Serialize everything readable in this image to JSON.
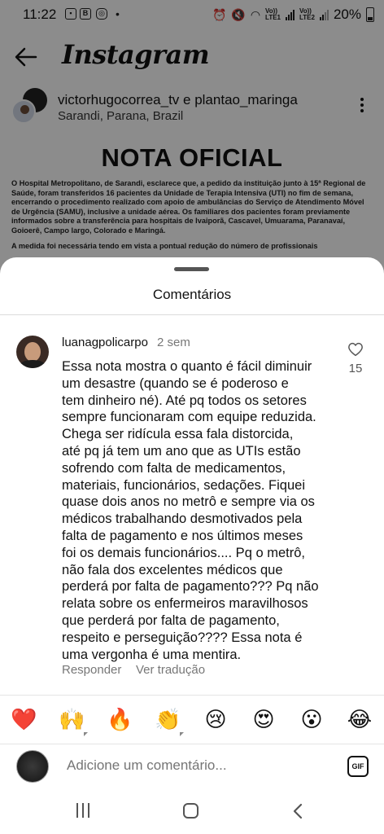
{
  "status_bar": {
    "time": "11:22",
    "dot": "•",
    "battery": "20%",
    "sim1": "Vo))\nLTE1",
    "sim2": "Vo))\nLTE2"
  },
  "header": {
    "logo": "Instagram",
    "back_icon": "arrow-left-icon"
  },
  "post": {
    "authors": "victorhugocorrea_tv e plantao_maringa",
    "location": "Sarandi, Parana, Brazil",
    "headline": "NOTA OFICIAL",
    "text": "O Hospital Metropolitano, de Sarandi, esclarece que, a pedido da instituição junto à 15ª Regional de Saúde, foram transferidos 16 pacientes da Unidade de Terapia Intensiva (UTI) no fim de semana, encerrando o procedimento realizado com apoio de ambulâncias do Serviço de Atendimento Móvel de Urgência (SAMU), inclusive a unidade aérea. Os familiares dos pacientes foram previamente informados sobre a transferência para hospitais de Ivaiporã, Cascavel, Umuarama, Paranavaí, Goioerê, Campo largo, Colorado e Maringá.",
    "text2": "A medida foi necessária tendo em vista a pontual redução do número de profissionais"
  },
  "comments_sheet": {
    "title": "Comentários",
    "comment": {
      "username": "luanagpolicarpo",
      "time": "2 sem",
      "likes": "15",
      "lines": [
        "Essa nota mostra o quanto é fácil diminuir",
        "um desastre (quando se é poderoso e",
        "tem dinheiro né). Até pq todos os setores",
        "sempre funcionaram com equipe reduzida.",
        "Chega ser ridícula essa fala distorcida,",
        "até pq já tem um ano que as UTIs estão",
        "sofrendo com falta de medicamentos,",
        "materiais, funcionários, sedações. Fiquei",
        "quase dois anos no metrô e sempre via os",
        "médicos trabalhando desmotivados pela",
        "falta de pagamento e nos últimos meses",
        "foi os demais funcionários.... Pq o metrô,",
        "não fala dos excelentes médicos que",
        "perderá por falta de pagamento??? Pq não",
        "relata sobre os enfermeiros maravilhosos",
        "que perderá por falta de pagamento,",
        "respeito e perseguição???? Essa nota é",
        "uma vergonha é uma mentira."
      ],
      "reply_label": "Responder",
      "translate_label": "Ver tradução"
    },
    "emojis": [
      {
        "char": "❤️",
        "name": "red-heart-emoji"
      },
      {
        "char": "🙌",
        "name": "raising-hands-emoji"
      },
      {
        "char": "🔥",
        "name": "fire-emoji"
      },
      {
        "char": "👏",
        "name": "clapping-hands-emoji"
      },
      {
        "char": "😢",
        "name": "crying-face-emoji"
      },
      {
        "char": "😍",
        "name": "heart-eyes-emoji"
      },
      {
        "char": "😮",
        "name": "open-mouth-emoji"
      },
      {
        "char": "😂",
        "name": "tears-of-joy-emoji"
      }
    ],
    "input_placeholder": "Adicione um comentário...",
    "gif_label": "GIF"
  }
}
